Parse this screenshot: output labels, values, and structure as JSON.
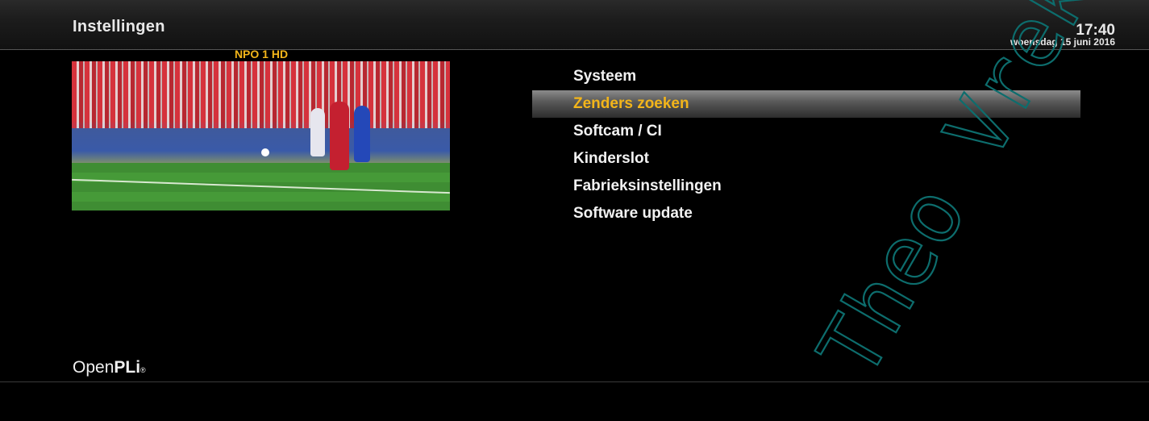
{
  "header": {
    "title": "Instellingen",
    "time": "17:40",
    "date": "woensdag 15 juni 2016"
  },
  "preview": {
    "channel": "NPO 1 HD"
  },
  "menu": {
    "items": [
      {
        "label": "Systeem",
        "selected": false
      },
      {
        "label": "Zenders zoeken",
        "selected": true
      },
      {
        "label": "Softcam / CI",
        "selected": false
      },
      {
        "label": "Kinderslot",
        "selected": false
      },
      {
        "label": "Fabrieksinstellingen",
        "selected": false
      },
      {
        "label": "Software update",
        "selected": false
      }
    ]
  },
  "branding": {
    "logo_prefix": "Open",
    "logo_suffix": "PLi",
    "logo_mark": "®"
  },
  "watermark": {
    "text": "Theo Vrek",
    "color": "#0d6d6d"
  },
  "colors": {
    "accent": "#f3b51a",
    "background": "#000000"
  }
}
